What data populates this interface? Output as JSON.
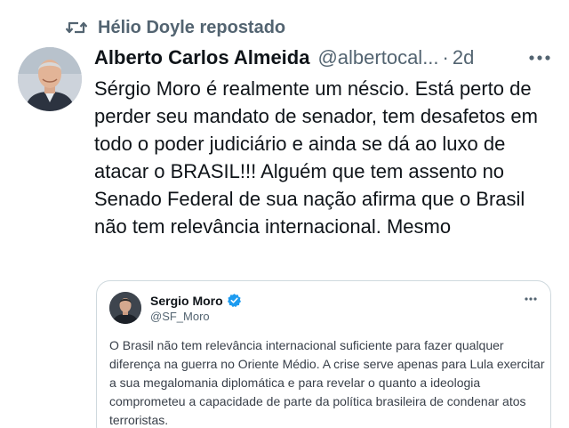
{
  "repost": {
    "icon": "repost-icon",
    "text": "Hélio Doyle repostado"
  },
  "post": {
    "author": {
      "name": "Alberto Carlos Almeida",
      "handle": "@albertocal...",
      "avatar_icon": "avatar-photo"
    },
    "separator": "·",
    "time": "2d",
    "more_icon": "more-icon",
    "text": "Sérgio Moro é realmente um néscio. Está perto de perder seu mandato de senador, tem desafetos em todo o poder judiciário e ainda se dá ao luxo de atacar o BRASIL!!! Alguém que tem assento no Senado Federal de sua nação afirma que o Brasil não tem relevância internacional. Mesmo"
  },
  "quote": {
    "author": {
      "name": "Sergio Moro",
      "handle": "@SF_Moro",
      "verified_icon": "verified-badge-icon",
      "avatar_icon": "avatar-photo"
    },
    "more_icon": "more-icon",
    "text": "O Brasil não tem relevância internacional suficiente para fazer qualquer diferença na guerra no Oriente Médio. A crise serve apenas para Lula exercitar a sua megalomania diplomática e para revelar o quanto a ideologia comprometeu a capacidade de parte da política brasileira de condenar atos terroristas."
  },
  "colors": {
    "text_primary": "#0f1419",
    "text_secondary": "#536471",
    "border": "#cfd9de",
    "verified_blue": "#1d9bf0"
  }
}
